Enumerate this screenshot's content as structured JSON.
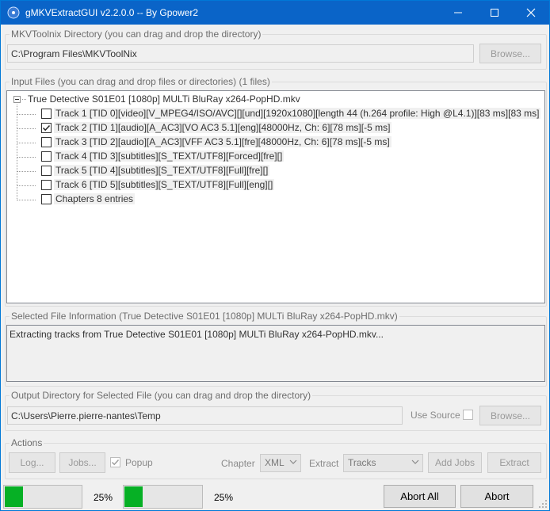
{
  "window": {
    "title": "gMKVExtractGUI v2.2.0.0 -- By Gpower2"
  },
  "mkvtoolnix": {
    "group_label": "MKVToolnix Directory (you can drag and drop the directory)",
    "path": "C:\\Program Files\\MKVToolNix",
    "browse_label": "Browse..."
  },
  "input_files": {
    "group_label": "Input Files (you can drag and drop files or directories) (1 files)",
    "root_label": "True Detective S01E01 [1080p] MULTi BluRay x264-PopHD.mkv",
    "items": [
      {
        "label": "Track 1 [TID 0][video][V_MPEG4/ISO/AVC][][und][1920x1080][length 44 (h.264 profile: High @L4.1)][83 ms][83 ms]",
        "checked": false
      },
      {
        "label": "Track 2 [TID 1][audio][A_AC3][VO AC3 5.1][eng][48000Hz, Ch: 6][78 ms][-5 ms]",
        "checked": true
      },
      {
        "label": "Track 3 [TID 2][audio][A_AC3][VFF AC3 5.1][fre][48000Hz, Ch: 6][78 ms][-5 ms]",
        "checked": false
      },
      {
        "label": "Track 4 [TID 3][subtitles][S_TEXT/UTF8][Forced][fre][]",
        "checked": false
      },
      {
        "label": "Track 5 [TID 4][subtitles][S_TEXT/UTF8][Full][fre][]",
        "checked": false
      },
      {
        "label": "Track 6 [TID 5][subtitles][S_TEXT/UTF8][Full][eng][]",
        "checked": false
      },
      {
        "label": "Chapters 8 entries",
        "checked": false
      }
    ]
  },
  "selected_info": {
    "group_label": "Selected File Information (True Detective S01E01 [1080p] MULTi BluRay x264-PopHD.mkv)",
    "text": "Extracting tracks from True Detective S01E01 [1080p] MULTi BluRay x264-PopHD.mkv..."
  },
  "output": {
    "group_label": "Output Directory for Selected File (you can drag and drop the directory)",
    "path": "C:\\Users\\Pierre.pierre-nantes\\Temp",
    "use_source_label": "Use Source",
    "browse_label": "Browse..."
  },
  "actions": {
    "group_label": "Actions",
    "log_label": "Log...",
    "jobs_label": "Jobs...",
    "popup_label": "Popup",
    "popup_checked": true,
    "chapter_label": "Chapter",
    "chapter_value": "XML",
    "extract_label": "Extract",
    "extract_value": "Tracks",
    "add_jobs_label": "Add Jobs",
    "extract_button_label": "Extract"
  },
  "progress": {
    "current_value": 0.25,
    "current_text": "25%",
    "total_value": 0.25,
    "total_text": "25%",
    "abort_all_label": "Abort All",
    "abort_label": "Abort"
  },
  "colors": {
    "titlebar": "#0a64c8",
    "progress_fill": "#06b025"
  }
}
